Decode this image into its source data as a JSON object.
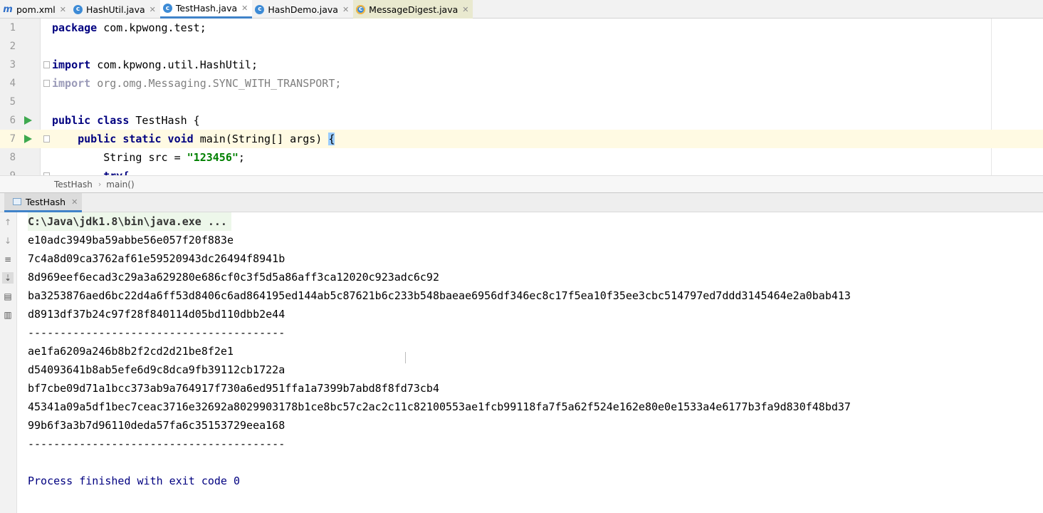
{
  "editor_tabs": [
    {
      "label": "pom.xml",
      "icon": "maven-icon"
    },
    {
      "label": "HashUtil.java",
      "icon": "java-class-icon"
    },
    {
      "label": "TestHash.java",
      "icon": "java-class-icon",
      "active": true
    },
    {
      "label": "HashDemo.java",
      "icon": "java-class-icon"
    },
    {
      "label": "MessageDigest.java",
      "icon": "library-class-icon"
    }
  ],
  "editor": {
    "line_numbers": [
      "1",
      "2",
      "3",
      "4",
      "5",
      "6",
      "7",
      "8",
      "9"
    ],
    "lines": {
      "l1_kw": "package",
      "l1_rest": " com.kpwong.test;",
      "l3_kw": "import",
      "l3_rest": " com.kpwong.util.HashUtil;",
      "l4_kw": "import",
      "l4_rest": " org.omg.Messaging.SYNC_WITH_TRANSPORT;",
      "l6_kw": "public class",
      "l6_rest": " TestHash {",
      "l7_indent": "    ",
      "l7_kw": "public static void",
      "l7_rest": " main(String[] args) ",
      "l7_brace": "{",
      "l8_prefix": "        String src = ",
      "l8_str": "\"123456\"",
      "l8_end": ";",
      "l9_partial": "        try{"
    }
  },
  "breadcrumb": {
    "items": [
      "TestHash",
      "main()"
    ],
    "separator": "›"
  },
  "run_window": {
    "tab_label": "TestHash",
    "console_lines": [
      "C:\\Java\\jdk1.8\\bin\\java.exe ...",
      "e10adc3949ba59abbe56e057f20f883e",
      "7c4a8d09ca3762af61e59520943dc26494f8941b",
      "8d969eef6ecad3c29a3a629280e686cf0c3f5d5a86aff3ca12020c923adc6c92",
      "ba3253876aed6bc22d4a6ff53d8406c6ad864195ed144ab5c87621b6c233b548baeae6956df346ec8c17f5ea10f35ee3cbc514797ed7ddd3145464e2a0bab413",
      "d8913df37b24c97f28f840114d05bd110dbb2e44",
      "----------------------------------------",
      "ae1fa6209a246b8b2f2cd2d21be8f2e1",
      "d54093641b8ab5efe6d9c8dca9fb39112cb1722a",
      "bf7cbe09d71a1bcc373ab9a764917f730a6ed951ffa1a7399b7abd8f8fd73cb4",
      "45341a09a5df1bec7ceac3716e32692a8029903178b1ce8bc57c2ac2c11c82100553ae1fcb99118fa7f5a62f524e162e80e0e1533a4e6177b3fa9d830f48bd37",
      "99b6f3a3b7d96110deda57fa6c35153729eea168",
      "----------------------------------------",
      "",
      "Process finished with exit code 0"
    ]
  },
  "colors": {
    "keyword": "#000080",
    "string": "#008000",
    "run_icon": "#3ea94f",
    "active_tab_underline": "#4083c9",
    "current_line": "#fffae3"
  }
}
